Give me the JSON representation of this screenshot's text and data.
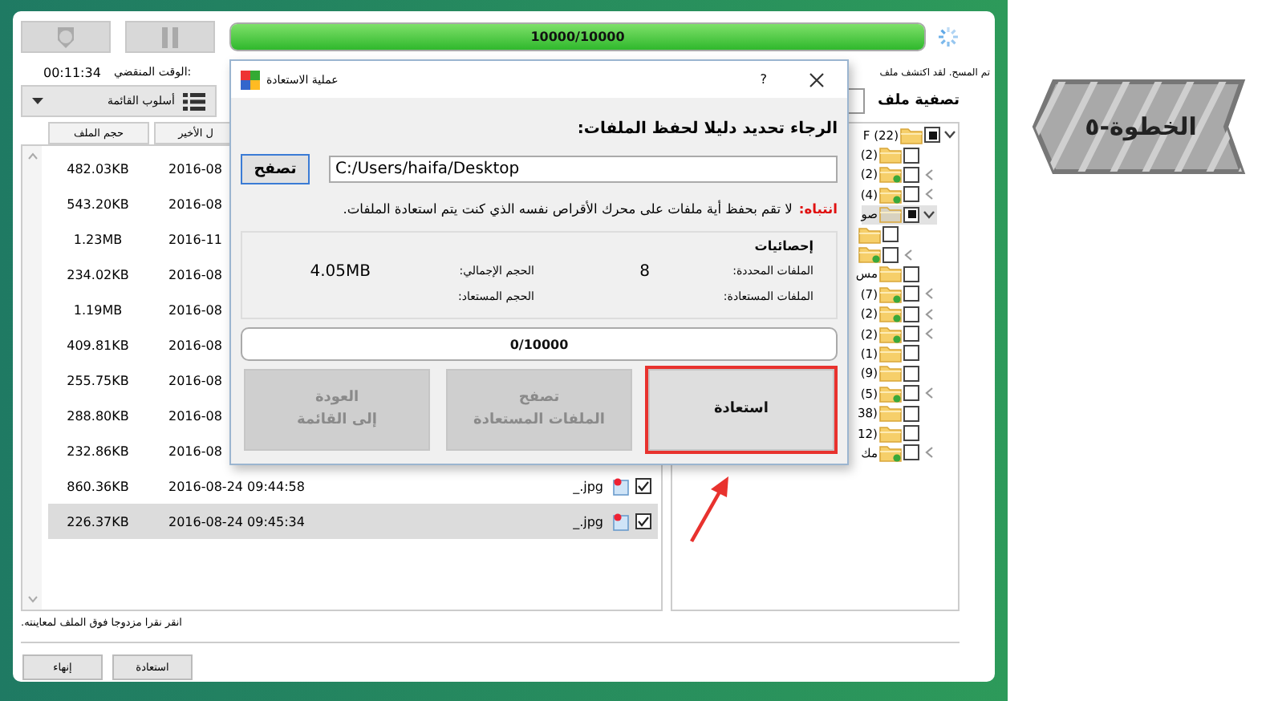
{
  "progress": {
    "text": "10000/10000",
    "level": 1
  },
  "elapsed": {
    "label": "الوقت المنقضي:",
    "value": "00:11:34"
  },
  "scan_status": "تم المسح. لقد اكتشف ملف",
  "view_mode": {
    "label": "أسلوب القائمة"
  },
  "filter": {
    "label": "تصفية ملف"
  },
  "file_list": {
    "columns": [
      "ل الأخير",
      "حجم الملف"
    ],
    "rows": [
      {
        "size": "482.03KB",
        "date": "2016-08",
        "selected": false
      },
      {
        "size": "543.20KB",
        "date": "2016-08",
        "selected": false
      },
      {
        "size": "1.23MB",
        "date": "2016-11",
        "selected": false
      },
      {
        "size": "234.02KB",
        "date": "2016-08",
        "selected": false
      },
      {
        "size": "1.19MB",
        "date": "2016-08",
        "selected": false
      },
      {
        "size": "409.81KB",
        "date": "2016-08",
        "selected": false
      },
      {
        "size": "255.75KB",
        "date": "2016-08",
        "selected": false
      },
      {
        "size": "288.80KB",
        "date": "2016-08",
        "selected": false
      },
      {
        "size": "232.86KB",
        "date": "2016-08",
        "selected": false
      },
      {
        "size": "860.36KB",
        "date": "2016-08-24 09:44:58",
        "name": "_.jpg",
        "checked": true,
        "selected": false
      },
      {
        "size": "226.37KB",
        "date": "2016-08-24 09:45:34",
        "name": "_.jpg",
        "checked": true,
        "selected": true
      }
    ]
  },
  "folder_tree": [
    {
      "label": "F (22)",
      "kind": "open",
      "partial": true,
      "selected": false,
      "children": [
        {
          "label": "(2)",
          "kind": "leaf",
          "partial": false,
          "selected": false
        },
        {
          "label": "(2)",
          "kind": "closed",
          "partial": false,
          "selected": false
        },
        {
          "label": "(4)",
          "kind": "closed",
          "partial": false,
          "selected": false
        },
        {
          "label": "صو",
          "kind": "open",
          "partial": true,
          "selected": true,
          "children": [
            {
              "kind": "leaf",
              "partial": false,
              "selected": false
            },
            {
              "kind": "closed",
              "partial": false,
              "selected": false
            }
          ]
        },
        {
          "label": "مس",
          "kind": "leaf",
          "partial": false,
          "selected": false
        },
        {
          "label": "(7)",
          "kind": "closed",
          "partial": false,
          "selected": false
        },
        {
          "label": "(2)",
          "kind": "closed",
          "partial": false,
          "selected": false
        },
        {
          "label": "(2)",
          "kind": "closed",
          "partial": false,
          "selected": false
        },
        {
          "label": "(1)",
          "kind": "leaf",
          "partial": false,
          "selected": false
        },
        {
          "label": "(9)",
          "kind": "leaf",
          "partial": false,
          "selected": false
        },
        {
          "label": "(5)",
          "kind": "closed",
          "partial": false,
          "selected": false
        },
        {
          "label": "38)",
          "kind": "leaf",
          "partial": false,
          "selected": false
        },
        {
          "label": "12)",
          "kind": "leaf",
          "partial": false,
          "selected": false
        },
        {
          "label": "مك",
          "kind": "closed",
          "partial": false,
          "selected": false
        }
      ]
    }
  ],
  "status_hint": "انقر نقرا مزدوجا فوق الملف لمعاينته.",
  "footer_buttons": [
    "استعادة",
    "إنهاء"
  ],
  "dialog": {
    "title": "عملية الاستعادة",
    "help": "?",
    "prompt": "الرجاء تحديد دليلا لحفظ الملفات:",
    "browse_button": "تصفح",
    "path": "C:/Users/haifa/Desktop",
    "warning_label": "انتباه:",
    "warning_text": "لا تقم بحفظ أية ملفات على محرك الأقراص نفسه الذي كنت يتم استعادة الملفات.",
    "stats": {
      "title": "إحصائيات",
      "items": [
        {
          "label": "الملفات المحددة:",
          "value": "8"
        },
        {
          "label": "الحجم الإجمالي:",
          "value": "4.05MB"
        },
        {
          "label": "الملفات المستعادة:"
        },
        {
          "label": "الحجم المستعاد:"
        }
      ]
    },
    "progress": {
      "text": "0/10000"
    },
    "buttons": [
      {
        "label": "استعادة",
        "disabled": false,
        "highlighted": true
      },
      {
        "label": "تصفح\nالملفات المستعادة",
        "disabled": true,
        "highlighted": false
      },
      {
        "label": "العودة\nإلى القائمة",
        "disabled": true,
        "highlighted": false
      }
    ]
  },
  "step_banner": "الخطوة-٥"
}
